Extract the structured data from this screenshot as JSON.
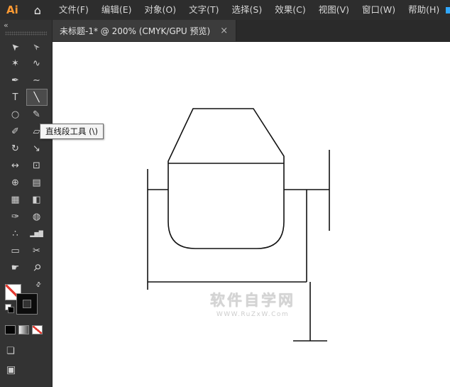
{
  "menubar": {
    "logo": "Ai",
    "items": [
      {
        "id": "file",
        "label": "文件(F)"
      },
      {
        "id": "edit",
        "label": "编辑(E)"
      },
      {
        "id": "object",
        "label": "对象(O)"
      },
      {
        "id": "type",
        "label": "文字(T)"
      },
      {
        "id": "select",
        "label": "选择(S)"
      },
      {
        "id": "effect",
        "label": "效果(C)"
      },
      {
        "id": "view",
        "label": "视图(V)"
      },
      {
        "id": "window",
        "label": "窗口(W)"
      },
      {
        "id": "help",
        "label": "帮助(H)"
      }
    ]
  },
  "tabbar": {
    "title": "未标题-1* @ 200% (CMYK/GPU 预览)",
    "close_label": "×"
  },
  "toolbar": {
    "collapse_label": "«",
    "tools": [
      {
        "id": "selection-tool",
        "glyph": "➤",
        "selected": false
      },
      {
        "id": "direct-selection-tool",
        "glyph": "➢",
        "selected": false
      },
      {
        "id": "magic-wand-tool",
        "glyph": "✶",
        "selected": false
      },
      {
        "id": "lasso-tool",
        "glyph": "∿",
        "selected": false
      },
      {
        "id": "pen-tool",
        "glyph": "✒",
        "selected": false
      },
      {
        "id": "curvature-tool",
        "glyph": "∼",
        "selected": false
      },
      {
        "id": "type-tool",
        "glyph": "T",
        "selected": false
      },
      {
        "id": "line-segment-tool",
        "glyph": "╲",
        "selected": true
      },
      {
        "id": "ellipse-tool",
        "glyph": "○",
        "selected": false
      },
      {
        "id": "paintbrush-tool",
        "glyph": "✎",
        "selected": false
      },
      {
        "id": "pencil-tool",
        "glyph": "✐",
        "selected": false
      },
      {
        "id": "eraser-tool",
        "glyph": "▱",
        "selected": false
      },
      {
        "id": "rotate-tool",
        "glyph": "↻",
        "selected": false
      },
      {
        "id": "scale-tool",
        "glyph": "↘",
        "selected": false
      },
      {
        "id": "width-tool",
        "glyph": "↔",
        "selected": false
      },
      {
        "id": "free-transform-tool",
        "glyph": "⊡",
        "selected": false
      },
      {
        "id": "shape-builder-tool",
        "glyph": "⊕",
        "selected": false
      },
      {
        "id": "perspective-grid-tool",
        "glyph": "▤",
        "selected": false
      },
      {
        "id": "mesh-tool",
        "glyph": "▦",
        "selected": false
      },
      {
        "id": "gradient-tool",
        "glyph": "◧",
        "selected": false
      },
      {
        "id": "eyedropper-tool",
        "glyph": "✑",
        "selected": false
      },
      {
        "id": "blend-tool",
        "glyph": "◍",
        "selected": false
      },
      {
        "id": "symbol-sprayer-tool",
        "glyph": "∴",
        "selected": false
      },
      {
        "id": "column-graph-tool",
        "glyph": "▂▆█",
        "selected": false
      },
      {
        "id": "artboard-tool",
        "glyph": "▭",
        "selected": false
      },
      {
        "id": "slice-tool",
        "glyph": "✂",
        "selected": false
      },
      {
        "id": "hand-tool",
        "glyph": "☛",
        "selected": false
      },
      {
        "id": "zoom-tool",
        "glyph": "⚲",
        "selected": false
      }
    ],
    "appearance": {
      "fill": "none",
      "stroke": "#000000"
    }
  },
  "tooltip": {
    "text": "直线段工具 (\\)"
  },
  "canvas": {
    "watermark_title": "软件自学网",
    "watermark_subtitle": "WWW.RuZxW.Com"
  },
  "colors": {
    "logo_orange": "#ff9a33",
    "workspace_accent_blue": "#31a8ff",
    "none_slash_red": "#e3392f",
    "ui_dark": "#333333",
    "artwork_stroke": "#111111"
  }
}
